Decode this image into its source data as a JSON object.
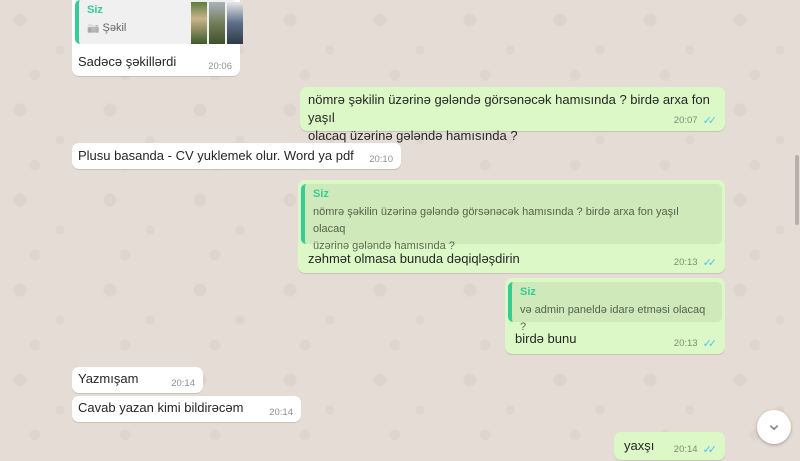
{
  "messages": [
    {
      "id": "m1",
      "direction": "in",
      "quote": {
        "author": "Siz",
        "text": "Şəkil",
        "icon": "camera-icon"
      },
      "text": "Sadəcə şəkillərdi",
      "time": "20:06"
    },
    {
      "id": "m2",
      "direction": "out",
      "text_line1": "nömrə şəkilin üzərinə gələndə görsənəcək hamısında ? birdə arxa fon yaşıl",
      "text_line2": "olacaq üzərinə gələndə hamısında ?",
      "time": "20:07",
      "status": "read"
    },
    {
      "id": "m3",
      "direction": "in",
      "text": "Plusu basanda - CV yuklemek olur. Word ya pdf",
      "time": "20:10"
    },
    {
      "id": "m4",
      "direction": "out",
      "quote": {
        "author": "Siz",
        "text_line1": "nömrə şəkilin üzərinə gələndə görsənəcək hamısında ? birdə arxa fon yaşıl olacaq",
        "text_line2": "üzərinə gələndə hamısında ?"
      },
      "text": "zəhmət olmasa bunuda dəqiqləşdirin",
      "time": "20:13",
      "status": "read"
    },
    {
      "id": "m5",
      "direction": "out",
      "quote": {
        "author": "Siz",
        "text": "və admin paneldə idarə etməsi olacaq ?"
      },
      "text": "birdə bunu",
      "time": "20:13",
      "status": "read"
    },
    {
      "id": "m6",
      "direction": "in",
      "text": "Yazmışam",
      "time": "20:14"
    },
    {
      "id": "m7",
      "direction": "in",
      "text": "Cavab yazan kimi bildirəcəm",
      "time": "20:14"
    },
    {
      "id": "m8",
      "direction": "out",
      "text": "yaxşı",
      "time": "20:14",
      "status": "read"
    }
  ],
  "colors": {
    "incoming": "#ffffff",
    "outgoing": "#dcf8c6",
    "quote_accent": "#35cd96",
    "read_ticks": "#4fc3f7",
    "wallpaper": "#e5ddd5"
  },
  "icons": {
    "read_ticks": "✓✓",
    "scroll_down": "chevron-down-icon",
    "scroll_down_glyph": "⌄",
    "camera_glyph": "📷"
  }
}
